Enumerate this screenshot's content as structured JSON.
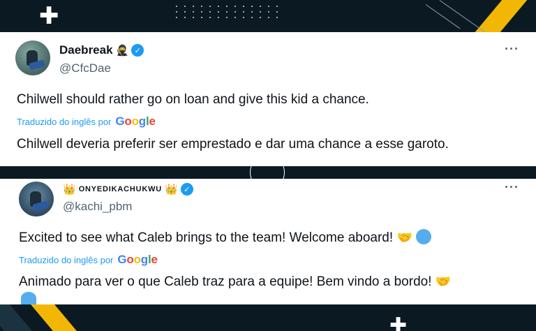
{
  "background": {
    "accent_color": "#f2b705",
    "base_color": "#0b1a22"
  },
  "tweets": [
    {
      "display_name": "Daebreak",
      "name_emoji": "🥷",
      "handle": "@CfcDae",
      "more_label": "···",
      "text": "Chilwell should rather go on loan and give this kid a chance.",
      "translated_label": "Traduzido do inglês por",
      "translator_brand": "Google",
      "translation": "Chilwell deveria preferir ser emprestado e dar uma chance a esse garoto."
    },
    {
      "display_name": "ONYEDIKACHUKWU",
      "name_emoji_left": "👑",
      "name_emoji_right": "👑",
      "handle": "@kachi_pbm",
      "more_label": "···",
      "text": "Excited to see what Caleb brings to the team! Welcome aboard!",
      "text_emoji": "🤝",
      "translated_label": "Traduzido do inglês por",
      "translator_brand": "Google",
      "translation": "Animado para ver o que Caleb traz para a equipe! Bem vindo a bordo!",
      "translation_emoji": "🤝"
    }
  ],
  "colors": {
    "verified": "#1d9bf0",
    "link": "#1d9bf0",
    "text": "#0f1419",
    "muted": "#536471"
  }
}
